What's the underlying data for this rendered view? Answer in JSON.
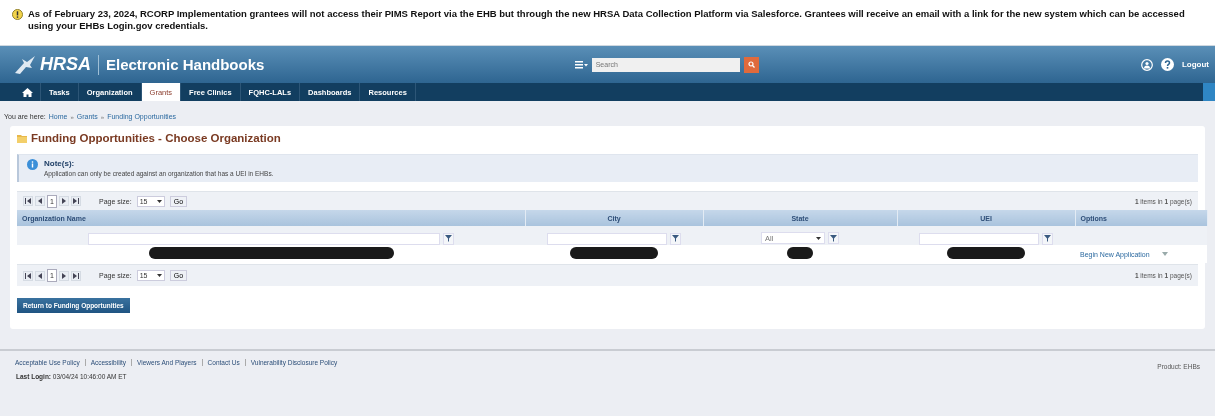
{
  "announcement": {
    "text": "As of February 23, 2024, RCORP Implementation grantees will not access their PIMS Report via the EHB but through the new HRSA Data Collection Platform via Salesforce.  Grantees will receive an email with a link for the new system which can be accessed using your EHBs Login.gov credentials."
  },
  "header": {
    "logo": "HRSA",
    "title": "Electronic Handbooks",
    "search_placeholder": "Search",
    "logout": "Logout"
  },
  "nav": [
    {
      "label": "Tasks",
      "selected": false
    },
    {
      "label": "Organization",
      "selected": false
    },
    {
      "label": "Grants",
      "selected": true
    },
    {
      "label": "Free Clinics",
      "selected": false
    },
    {
      "label": "FQHC-LALs",
      "selected": false
    },
    {
      "label": "Dashboards",
      "selected": false
    },
    {
      "label": "Resources",
      "selected": false
    }
  ],
  "breadcrumb": {
    "prefix": "You are here:",
    "items": [
      "Home",
      "Grants",
      "Funding Opportunities"
    ],
    "separator": "»"
  },
  "page_title": "Funding Opportunities - Choose Organization",
  "note": {
    "title": "Note(s):",
    "text": "Application can only be created against an organization that has a UEI in EHBs."
  },
  "pagers": [
    {
      "page": "1",
      "page_size_label": "Page size:",
      "page_size": "15",
      "go": "Go",
      "summary": "**1** items in **1** page(s)"
    },
    {
      "page": "1",
      "page_size_label": "Page size:",
      "page_size": "15",
      "go": "Go",
      "summary": "**1** items in **1** page(s)"
    }
  ],
  "table": {
    "columns": [
      {
        "label": "Organization Name",
        "kind": "text"
      },
      {
        "label": "City",
        "kind": "text"
      },
      {
        "label": "State",
        "kind": "select",
        "value": "All"
      },
      {
        "label": "UEI",
        "kind": "text"
      },
      {
        "label": "Options"
      }
    ],
    "rows": [
      [
        {
          "kind": "redacted"
        },
        {
          "kind": "redacted"
        },
        {
          "kind": "redacted"
        },
        {
          "kind": "redacted"
        },
        {
          "kind": "menu",
          "text": "Begin New Application"
        }
      ]
    ]
  },
  "return_button": "Return to Funding Opportunities",
  "footer": {
    "links": [
      "Acceptable Use Policy",
      "Accessibility",
      "Viewers And Players",
      "Contact Us",
      "Vulnerability Disclosure Policy"
    ],
    "last_login_label": "Last Login:",
    "last_login": "03/04/24 10:46:00 AM ET",
    "product": "Product: EHBs"
  }
}
